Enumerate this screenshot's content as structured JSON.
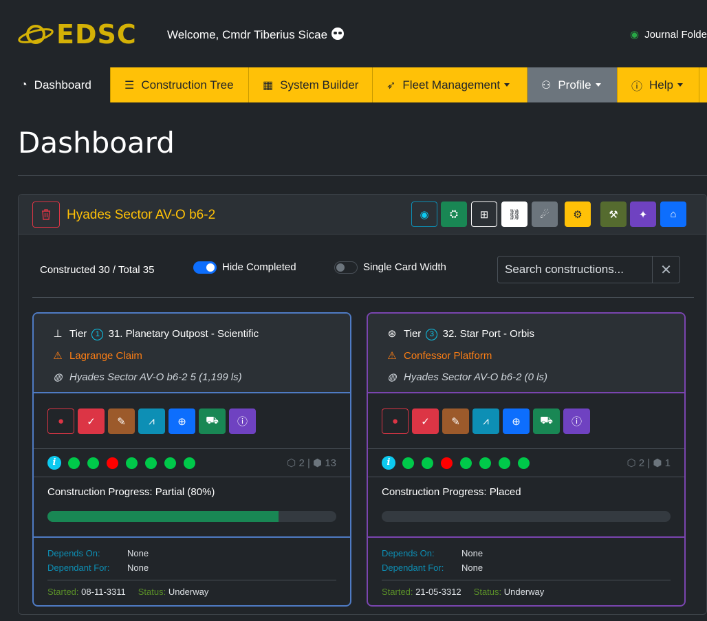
{
  "header": {
    "brand": "EDSC",
    "welcome": "Welcome, Cmdr Tiberius Sicae",
    "journal": "Journal Folde"
  },
  "nav": [
    {
      "label": "Dashboard",
      "icon": "gauge-icon"
    },
    {
      "label": "Construction Tree",
      "icon": "tree-list-icon"
    },
    {
      "label": "System Builder",
      "icon": "building-icon"
    },
    {
      "label": "Fleet Management",
      "icon": "rocket-icon"
    },
    {
      "label": "Profile",
      "icon": "user-gear-icon"
    },
    {
      "label": "Help",
      "icon": "question-circle-icon"
    }
  ],
  "page_title": "Dashboard",
  "system": {
    "name": "Hyades Sector AV-O b6-2",
    "stats": "Constructed 30 / Total 35",
    "hide_completed": "Hide Completed",
    "single_card_width": "Single Card Width",
    "search_placeholder": "Search constructions..."
  },
  "cards": [
    {
      "tier_label": "Tier",
      "tier": "1",
      "name": "31. Planetary Outpost - Scientific",
      "claim": "Lagrange Claim",
      "location": "Hyades Sector AV-O b6-2 5 (1,199 ls)",
      "count_a": "2",
      "count_b": "13",
      "progress_label": "Construction Progress: Partial (80%)",
      "progress": 0.8,
      "depends_on_label": "Depends On:",
      "depends_on": "None",
      "dependant_for_label": "Dependant For:",
      "dependant_for": "None",
      "started_label": "Started:",
      "started": "08-11-3311",
      "status_label": "Status:",
      "status": "Underway",
      "border_color": "#4f7bc4"
    },
    {
      "tier_label": "Tier",
      "tier": "3",
      "name": "32. Star Port - Orbis",
      "claim": "Confessor Platform",
      "location": "Hyades Sector AV-O b6-2 (0 ls)",
      "count_a": "2",
      "count_b": "1",
      "progress_label": "Construction Progress: Placed",
      "progress": 0,
      "depends_on_label": "Depends On:",
      "depends_on": "None",
      "dependant_for_label": "Dependant For:",
      "dependant_for": "None",
      "started_label": "Started:",
      "started": "21-05-3312",
      "status_label": "Status:",
      "status": "Underway",
      "border_color": "#7a45b0"
    }
  ],
  "colors": {
    "accent": "#ffc107",
    "green_dot": "#00c94a",
    "red_dot": "#ff0000"
  }
}
